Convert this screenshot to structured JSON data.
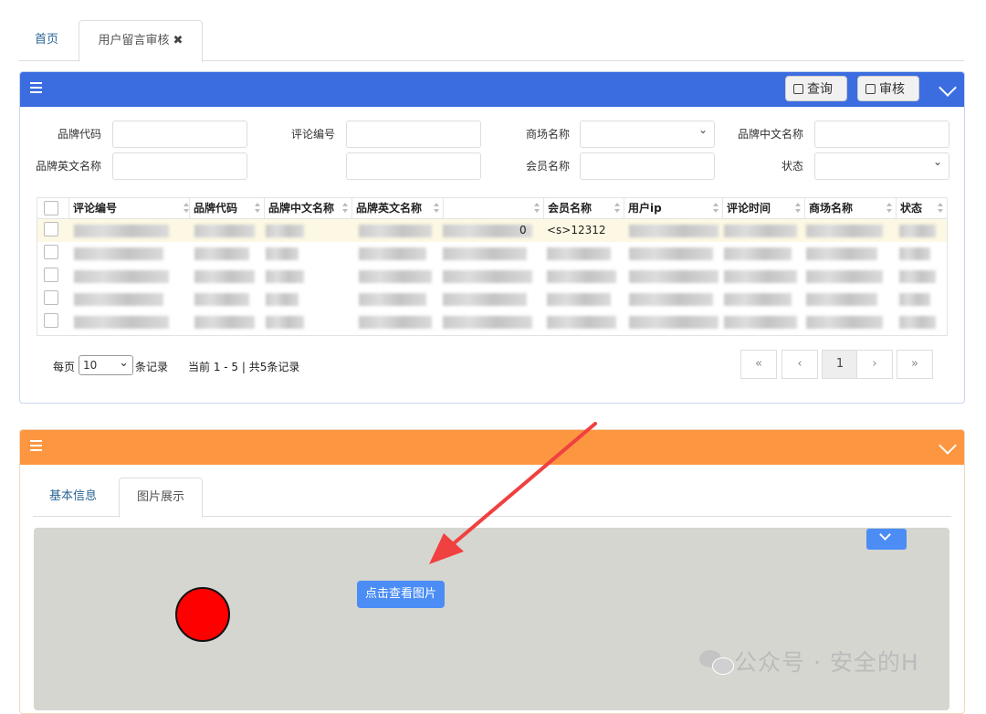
{
  "tabs": [
    {
      "label": "首页"
    },
    {
      "label": "用户留言审核",
      "close": "✖"
    }
  ],
  "panel1": {
    "buttons": {
      "query": "查询",
      "review": "审核"
    },
    "filters": [
      {
        "label": "品牌代码"
      },
      {
        "label": "评论编号"
      },
      {
        "label": "商场名称",
        "type": "select"
      },
      {
        "label": "品牌中文名称"
      },
      {
        "label": "品牌英文名称"
      },
      {
        "label": ""
      },
      {
        "label": "会员名称"
      },
      {
        "label": "状态",
        "type": "select"
      }
    ],
    "table": {
      "columns": [
        "评论编号",
        "品牌代码",
        "品牌中文名称",
        "品牌英文名称",
        "",
        "会员名称",
        "用户ip",
        "评论时间",
        "商场名称",
        "状态"
      ],
      "visible_cells": {
        "row1_member": "<s>12312",
        "row1_col5_tail": "0"
      },
      "rows_shown": 5
    },
    "pagination": {
      "per_page_prefix": "每页",
      "per_page_value": "10",
      "per_page_suffix": "条记录",
      "summary": "当前 1 - 5 | 共5条记录",
      "buttons": [
        "«",
        "‹",
        "1",
        "›",
        "»"
      ],
      "current_page": "1"
    }
  },
  "panel2": {
    "subtabs": [
      {
        "label": "基本信息"
      },
      {
        "label": "图片展示"
      }
    ],
    "view_image_button": "点击查看图片"
  },
  "watermark": "公众号 · 安全的H",
  "colors": {
    "primary_header": "#3b6de0",
    "secondary_header": "#fc9640",
    "button_blue": "#4b8df5",
    "arrow": "#f04040",
    "marker": "#ff0000"
  },
  "icons": [
    "menu-icon",
    "edit-icon",
    "chevron-down-icon",
    "close-icon",
    "wechat-icon"
  ]
}
